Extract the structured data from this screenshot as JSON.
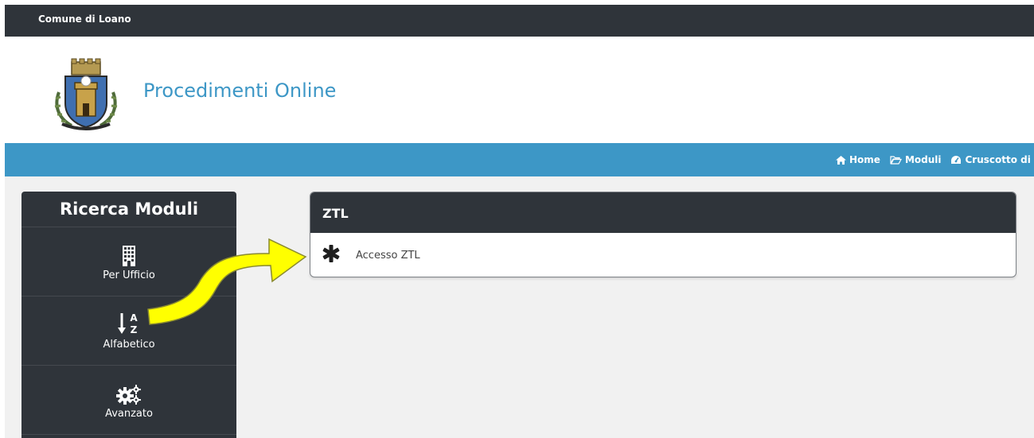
{
  "topbar": {
    "org_name": "Comune di Loano"
  },
  "header": {
    "site_title": "Procedimenti Online",
    "logo_icon": "municipal-coat-of-arms"
  },
  "navbar": {
    "items": [
      {
        "label": "Home",
        "icon": "home-icon"
      },
      {
        "label": "Moduli",
        "icon": "folder-open-icon"
      },
      {
        "label": "Cruscotto di G",
        "icon": "dashboard-icon"
      }
    ]
  },
  "sidebar": {
    "title": "Ricerca Moduli",
    "items": [
      {
        "label": "Per Ufficio",
        "icon": "building-icon"
      },
      {
        "label": "Alfabetico",
        "icon": "sort-alpha-icon"
      },
      {
        "label": "Avanzato",
        "icon": "gears-icon"
      }
    ]
  },
  "panel": {
    "title": "ZTL",
    "rows": [
      {
        "label": "Accesso ZTL",
        "icon": "asterisk-icon"
      }
    ]
  },
  "annotation": {
    "arrow_color": "#ffff00"
  },
  "colors": {
    "dark": "#2f343a",
    "accent": "#3d97c6",
    "background": "#f1f1f1"
  }
}
